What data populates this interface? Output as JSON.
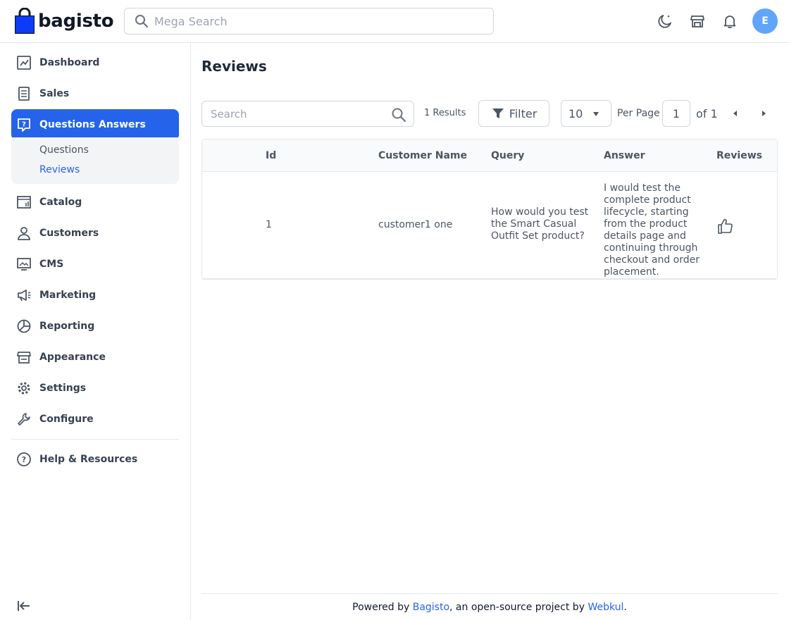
{
  "app": {
    "name": "bagisto"
  },
  "header": {
    "search_placeholder": "Mega Search",
    "avatar_initial": "E",
    "icons": [
      "dark-mode-moon-icon",
      "storefront-icon",
      "notification-bell-icon"
    ]
  },
  "sidebar": {
    "items": [
      {
        "label": "Dashboard",
        "icon": "dashboard-chart-icon"
      },
      {
        "label": "Sales",
        "icon": "sales-receipt-icon"
      },
      {
        "label": "Questions Answers",
        "icon": "question-bubble-icon",
        "active": true
      },
      {
        "label": "Catalog",
        "icon": "catalog-icon"
      },
      {
        "label": "Customers",
        "icon": "customer-person-icon"
      },
      {
        "label": "CMS",
        "icon": "cms-monitor-icon"
      },
      {
        "label": "Marketing",
        "icon": "megaphone-icon"
      },
      {
        "label": "Reporting",
        "icon": "pie-chart-icon"
      },
      {
        "label": "Appearance",
        "icon": "store-front-icon"
      },
      {
        "label": "Settings",
        "icon": "gear-icon"
      },
      {
        "label": "Configure",
        "icon": "wrench-icon"
      }
    ],
    "submenu": [
      {
        "label": "Questions",
        "active": false
      },
      {
        "label": "Reviews",
        "active": true
      }
    ],
    "help": {
      "label": "Help & Resources",
      "icon": "help-circle-icon"
    }
  },
  "page": {
    "title": "Reviews",
    "search_placeholder": "Search",
    "results": "1 Results",
    "filter_label": "Filter",
    "per_page_value": "10",
    "per_page_label": "Per Page",
    "current_page": "1",
    "of_label": "of 1"
  },
  "table": {
    "headers": [
      "Id",
      "Customer Name",
      "Query",
      "Answer",
      "Reviews"
    ],
    "rows": [
      {
        "id": "1",
        "customer_name": "customer1 one",
        "query": "How would you test the Smart Casual Outfit Set product?",
        "answer": "I would test the complete product lifecycle, starting from the product details page and continuing through checkout and order placement.",
        "reviews_icon": "thumbs-up-icon"
      }
    ]
  },
  "footer": {
    "prefix": "Powered by ",
    "brand": "Bagisto",
    "middle": ", an open-source project by ",
    "company": "Webkul",
    "suffix": "."
  },
  "colors": {
    "accent": "#2563eb",
    "avatar": "#60a5fa"
  }
}
